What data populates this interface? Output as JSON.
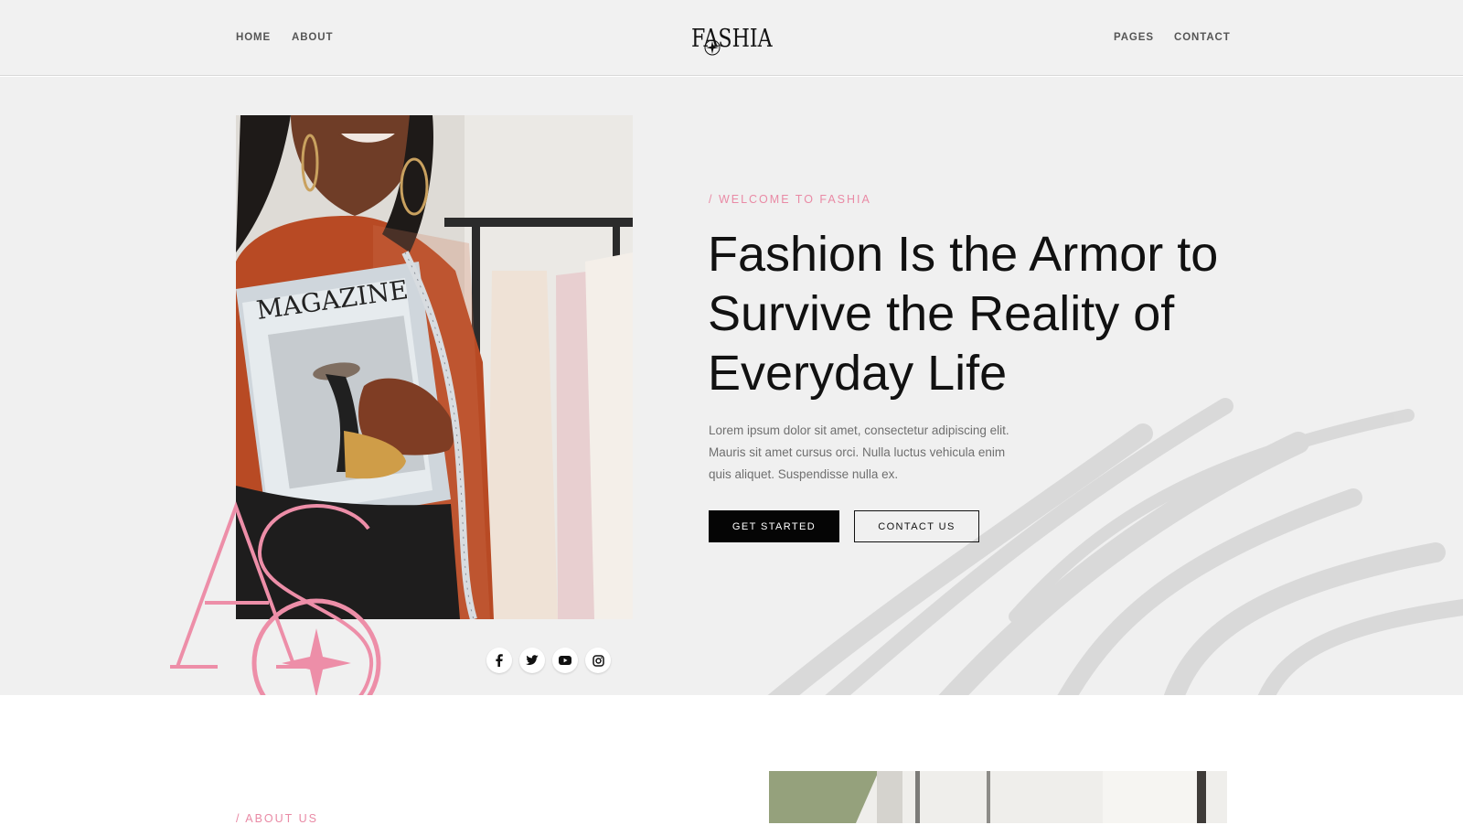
{
  "nav": {
    "left": [
      "HOME",
      "ABOUT"
    ],
    "right": [
      "PAGES",
      "CONTACT"
    ]
  },
  "brand": {
    "logo_text": "FASHIA"
  },
  "hero": {
    "eyebrow": "/ WELCOME TO FASHIA",
    "title": "Fashion Is the Armor to Survive the Reality of Everyday Life",
    "body": "Lorem ipsum dolor sit amet, consectetur adipiscing elit. Mauris sit amet cursus orci. Nulla luctus vehicula enim quis aliquet. Suspendisse nulla ex.",
    "primary_button": "GET STARTED",
    "secondary_button": "CONTACT US",
    "photo_text": "MAGAZINE",
    "monogram": "AS",
    "social_icons": [
      "facebook-icon",
      "twitter-icon",
      "youtube-icon",
      "instagram-icon"
    ]
  },
  "about": {
    "eyebrow": "/ ABOUT US"
  },
  "colors": {
    "accent_pink": "#e98aa5",
    "header_bg": "#f1f1f1",
    "hero_bg": "#f0f0f0",
    "text_dark": "#111111",
    "button_dark": "#050505"
  }
}
